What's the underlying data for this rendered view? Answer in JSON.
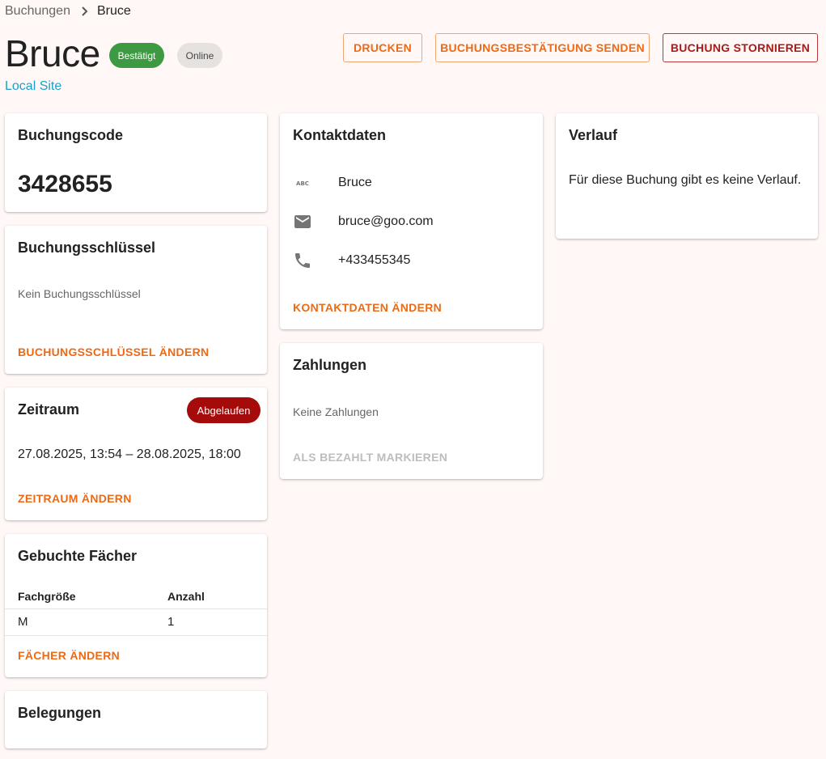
{
  "breadcrumb": {
    "parent": "Buchungen",
    "current": "Bruce"
  },
  "header": {
    "title": "Bruce",
    "status_chip": "Bestätigt",
    "channel_chip": "Online",
    "site_link": "Local Site"
  },
  "actions": {
    "print": "DRUCKEN",
    "send_confirmation": "BUCHUNGSBESTÄTIGUNG SENDEN",
    "cancel_booking": "BUCHUNG STORNIEREN"
  },
  "booking_code": {
    "title": "Buchungscode",
    "value": "3428655"
  },
  "booking_key": {
    "title": "Buchungsschlüssel",
    "empty_text": "Kein Buchungsschlüssel",
    "action": "BUCHUNGSSCHLÜSSEL ÄNDERN"
  },
  "period": {
    "title": "Zeitraum",
    "badge": "Abgelaufen",
    "range": "27.08.2025, 13:54 – 28.08.2025, 18:00",
    "action": "ZEITRAUM ÄNDERN"
  },
  "compartments": {
    "title": "Gebuchte Fächer",
    "columns": [
      "Fachgröße",
      "Anzahl"
    ],
    "rows": [
      [
        "M",
        "1"
      ]
    ],
    "action": "FÄCHER ÄNDERN"
  },
  "occupancies": {
    "title": "Belegungen"
  },
  "contact": {
    "title": "Kontaktdaten",
    "name": "Bruce",
    "email": "bruce@goo.com",
    "phone": "+433455345",
    "action": "KONTAKTDATEN ÄNDERN",
    "icons": [
      "abc-icon",
      "email-icon",
      "phone-icon"
    ]
  },
  "payments": {
    "title": "Zahlungen",
    "empty_text": "Keine Zahlungen",
    "action": "ALS BEZAHLT MARKIEREN"
  },
  "history": {
    "title": "Verlauf",
    "empty_text": "Für diese Buchung gibt es keine Verlauf."
  },
  "colors": {
    "background": "#fff8f6",
    "accent": "#ec6a16",
    "danger": "#a51b1b",
    "success": "#3d9a42",
    "link": "#1ba0c8"
  }
}
